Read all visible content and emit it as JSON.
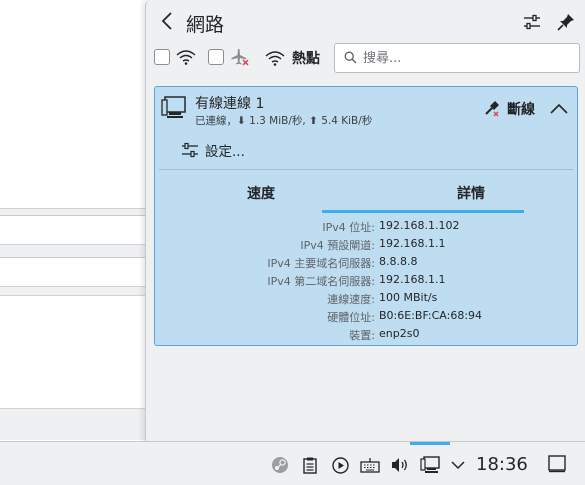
{
  "panel": {
    "title": "網路",
    "back_icon": "back-arrow-icon",
    "configure_icon": "sliders-icon",
    "pin_icon": "pin-icon"
  },
  "toolbar": {
    "wifi_checked": false,
    "airplane_checked": false,
    "hotspot_label": "熱點",
    "search_placeholder": "搜尋..."
  },
  "connection": {
    "name": "有線連線 1",
    "status": "已連線，⬇ 1.3 MiB/秒, ⬆ 5.4 KiB/秒",
    "disconnect_label": "斷線",
    "settings_label": "設定...",
    "tabs": [
      {
        "label": "速度",
        "active": false
      },
      {
        "label": "詳情",
        "active": true
      }
    ],
    "details": [
      {
        "key": "IPv4 位址:",
        "value": "192.168.1.102"
      },
      {
        "key": "IPv4 預設閘道:",
        "value": "192.168.1.1"
      },
      {
        "key": "IPv4 主要域名伺服器:",
        "value": "8.8.8.8"
      },
      {
        "key": "IPv4 第二域名伺服器:",
        "value": "192.168.1.1"
      },
      {
        "key": "連線速度:",
        "value": "100 MBit/s"
      },
      {
        "key": "硬體位址:",
        "value": "B0:6E:BF:CA:68:94"
      },
      {
        "key": "裝置:",
        "value": "enp2s0"
      }
    ]
  },
  "taskbar": {
    "clock": "18:36",
    "tray_icons": [
      "steam-icon",
      "clipboard-icon",
      "media-play-icon",
      "keyboard-icon",
      "volume-icon",
      "network-wired-icon",
      "expand-tray-icon",
      "show-desktop-icon"
    ]
  },
  "colors": {
    "accent": "#3daee9",
    "card_bg": "#bfddf1",
    "panel_bg": "#eff0f1"
  }
}
